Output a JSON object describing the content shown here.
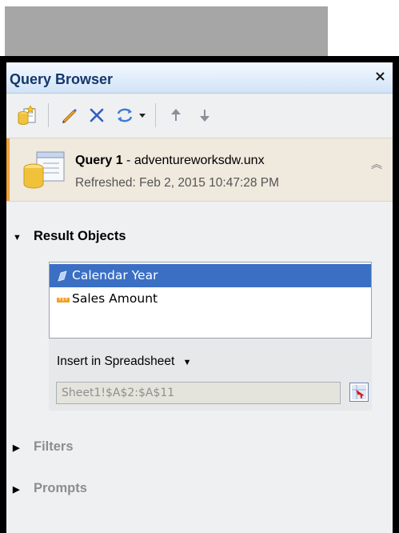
{
  "panel": {
    "title": "Query Browser",
    "close_symbol": "×"
  },
  "toolbar": {
    "icons": [
      "add-query-icon",
      "edit-icon",
      "delete-icon",
      "refresh-icon",
      "dropdown-arrow-icon",
      "move-up-icon",
      "move-down-icon"
    ]
  },
  "query": {
    "name": "Query 1",
    "source": " - adventureworksdw.unx",
    "refreshed": "Refreshed: Feb 2, 2015 10:47:28 PM"
  },
  "result_objects": {
    "heading": "Result Objects",
    "items": [
      {
        "label": "Calendar Year",
        "icon": "dimension-icon",
        "selected": true
      },
      {
        "label": "Sales Amount",
        "icon": "measure-icon",
        "selected": false
      }
    ],
    "insert_label": "Insert in Spreadsheet",
    "range_value": "Sheet1!$A$2:$A$11"
  },
  "filters": {
    "heading": "Filters"
  },
  "prompts": {
    "heading": "Prompts"
  },
  "colors": {
    "accent": "#f2a23a",
    "selection": "#3a6fc4",
    "title_text": "#14386b"
  }
}
